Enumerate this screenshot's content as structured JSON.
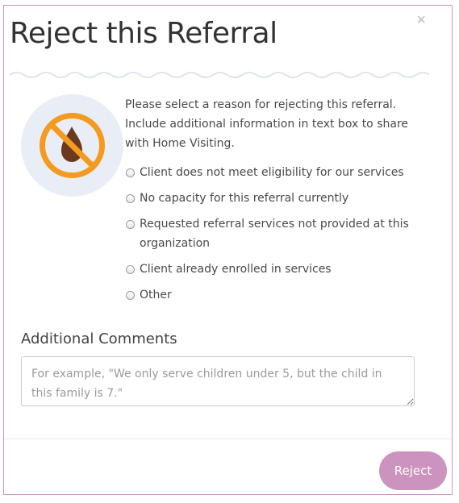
{
  "dialog": {
    "title": "Reject this Referral",
    "close_label": "×",
    "icon": "no-water-drop-icon",
    "intro": "Please select a reason for rejecting this referral. Include additional information in text box to share with Home Visiting.",
    "reasons": [
      {
        "label": "Client does not meet eligibility for our services",
        "selected": false
      },
      {
        "label": "No capacity for this referral currently",
        "selected": false
      },
      {
        "label": "Requested referral services not provided at this organization",
        "selected": false
      },
      {
        "label": "Client already enrolled in services",
        "selected": false
      },
      {
        "label": "Other",
        "selected": false
      }
    ],
    "comments_label": "Additional Comments",
    "comments_placeholder": "For example, \"We only serve children under 5, but the child in this family is 7.\"",
    "comments_value": "",
    "reject_label": "Reject"
  },
  "colors": {
    "border": "#c896c8",
    "icon_ring": "#f39a1f",
    "icon_drop": "#6b3a1e",
    "icon_bg": "#e9eef6",
    "button": "#c98ebb"
  }
}
